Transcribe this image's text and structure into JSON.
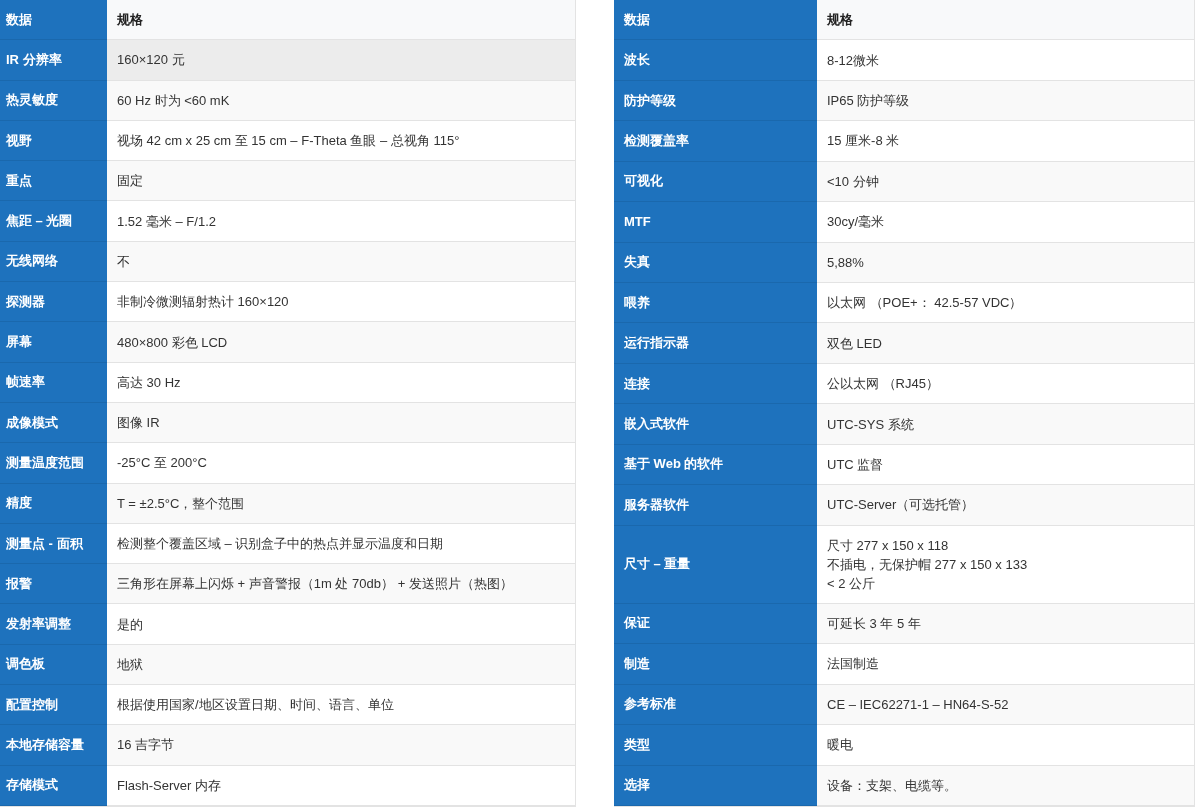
{
  "tables": [
    {
      "header": {
        "label": "数据",
        "value": "规格"
      },
      "rows": [
        {
          "label": "IR 分辨率",
          "lines": [
            "160×120 元"
          ],
          "hovered": true
        },
        {
          "label": "热灵敏度",
          "lines": [
            "60 Hz 时为 <60 mK"
          ],
          "hovered": false
        },
        {
          "label": "视野",
          "lines": [
            "视场 42 cm x 25 cm 至 15 cm – F-Theta 鱼眼 – 总视角 115°"
          ],
          "hovered": false
        },
        {
          "label": "重点",
          "lines": [
            "固定"
          ],
          "hovered": false
        },
        {
          "label": "焦距 – 光圈",
          "lines": [
            "1.52 毫米 – F/1.2"
          ],
          "hovered": false
        },
        {
          "label": "无线网络",
          "lines": [
            "不"
          ],
          "hovered": false
        },
        {
          "label": "探测器",
          "lines": [
            "非制冷微测辐射热计 160×120"
          ],
          "hovered": false
        },
        {
          "label": "屏幕",
          "lines": [
            "480×800 彩色 LCD"
          ],
          "hovered": false
        },
        {
          "label": "帧速率",
          "lines": [
            "高达 30 Hz"
          ],
          "hovered": false
        },
        {
          "label": "成像模式",
          "lines": [
            "图像 IR"
          ],
          "hovered": false
        },
        {
          "label": "测量温度范围",
          "lines": [
            "-25°C 至 200°C"
          ],
          "hovered": false
        },
        {
          "label": "精度",
          "lines": [
            "T = ±2.5°C，整个范围"
          ],
          "hovered": false
        },
        {
          "label": "测量点 - 面积",
          "lines": [
            "检测整个覆盖区域 – 识别盒子中的热点并显示温度和日期"
          ],
          "hovered": false
        },
        {
          "label": "报警",
          "lines": [
            "三角形在屏幕上闪烁 + 声音警报（1m 处 70db） + 发送照片（热图）"
          ],
          "hovered": false
        },
        {
          "label": "发射率调整",
          "lines": [
            "是的"
          ],
          "hovered": false
        },
        {
          "label": "调色板",
          "lines": [
            "地狱"
          ],
          "hovered": false
        },
        {
          "label": "配置控制",
          "lines": [
            "根据使用国家/地区设置日期、时间、语言、单位"
          ],
          "hovered": false
        },
        {
          "label": "本地存储容量",
          "lines": [
            "16 吉字节"
          ],
          "hovered": false
        },
        {
          "label": "存储模式",
          "lines": [
            "Flash-Server 内存"
          ],
          "hovered": false
        }
      ]
    },
    {
      "header": {
        "label": "数据",
        "value": "规格"
      },
      "rows": [
        {
          "label": "波长",
          "lines": [
            "8-12微米"
          ],
          "hovered": false
        },
        {
          "label": "防护等级",
          "lines": [
            "IP65 防护等级"
          ],
          "hovered": false
        },
        {
          "label": "检测覆盖率",
          "lines": [
            "15 厘米-8 米"
          ],
          "hovered": false
        },
        {
          "label": "可视化",
          "lines": [
            "<10 分钟"
          ],
          "hovered": false
        },
        {
          "label": "MTF",
          "lines": [
            "30cy/毫米"
          ],
          "hovered": false
        },
        {
          "label": "失真",
          "lines": [
            "5,88%"
          ],
          "hovered": false
        },
        {
          "label": "喂养",
          "lines": [
            "以太网 （POE+： 42.5-57 VDC）"
          ],
          "hovered": false
        },
        {
          "label": "运行指示器",
          "lines": [
            "双色 LED"
          ],
          "hovered": false
        },
        {
          "label": "连接",
          "lines": [
            "公以太网 （RJ45）"
          ],
          "hovered": false
        },
        {
          "label": "嵌入式软件",
          "lines": [
            "UTC-SYS 系统"
          ],
          "hovered": false
        },
        {
          "label": "基于 Web 的软件",
          "lines": [
            "UTC 监督"
          ],
          "hovered": false
        },
        {
          "label": "服务器软件",
          "lines": [
            "UTC-Server（可选托管）"
          ],
          "hovered": false
        },
        {
          "label": "尺寸 – 重量",
          "lines": [
            "尺寸 277 x 150 x 118",
            "不插电，无保护帽 277 x 150 x 133",
            "< 2 公斤"
          ],
          "hovered": false
        },
        {
          "label": "保证",
          "lines": [
            "可延长 3 年 5 年"
          ],
          "hovered": false
        },
        {
          "label": "制造",
          "lines": [
            "法国制造"
          ],
          "hovered": false
        },
        {
          "label": "参考标准",
          "lines": [
            "CE – IEC62271-1 – HN64-S-52"
          ],
          "hovered": false
        },
        {
          "label": "类型",
          "lines": [
            "暖电"
          ],
          "hovered": false
        },
        {
          "label": "选择",
          "lines": [
            "设备：支架、电缆等。"
          ],
          "hovered": false
        }
      ]
    }
  ]
}
